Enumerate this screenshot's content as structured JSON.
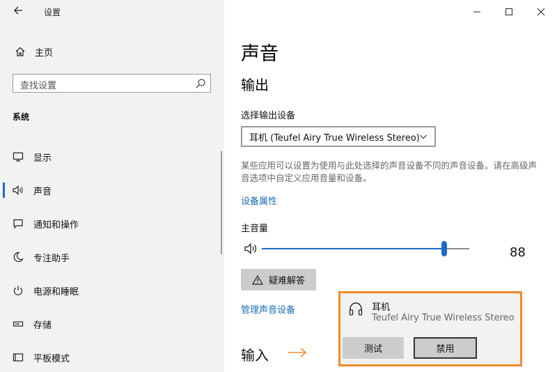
{
  "window": {
    "app_title": "设置",
    "back_icon": "back-arrow-icon",
    "controls": [
      "minimize-icon",
      "maximize-icon",
      "close-icon"
    ]
  },
  "sidebar": {
    "home_label": "主页",
    "search_placeholder": "查找设置",
    "section_title": "系统",
    "items": [
      {
        "label": "显示",
        "icon": "monitor-icon"
      },
      {
        "label": "声音",
        "icon": "speaker-icon",
        "active": true
      },
      {
        "label": "通知和操作",
        "icon": "notification-icon"
      },
      {
        "label": "专注助手",
        "icon": "moon-icon"
      },
      {
        "label": "电源和睡眠",
        "icon": "power-icon"
      },
      {
        "label": "存储",
        "icon": "storage-icon"
      },
      {
        "label": "平板模式",
        "icon": "tablet-icon"
      }
    ]
  },
  "main": {
    "page_title": "声音",
    "output_title": "输出",
    "choose_device_label": "选择输出设备",
    "selected_device": "耳机 (Teufel Airy True Wireless Stereo)",
    "help_text": "某些应用可以设置为使用与此处选择的声音设备不同的声音设备。请在高级声音选项中自定义应用音量和设备。",
    "device_properties_link": "设备属性",
    "master_volume_label": "主音量",
    "volume": 88,
    "troubleshoot_label": "疑难解答",
    "manage_devices_link": "管理声音设备",
    "input_title": "输入"
  },
  "popup": {
    "device_name": "耳机",
    "device_desc": "Teufel Airy True Wireless Stereo",
    "test_label": "测试",
    "disable_label": "禁用",
    "border_color": "#f08a2c"
  },
  "colors": {
    "accent": "#1b6ac4",
    "link": "#1a6cb5",
    "highlight": "#f08a2c"
  }
}
